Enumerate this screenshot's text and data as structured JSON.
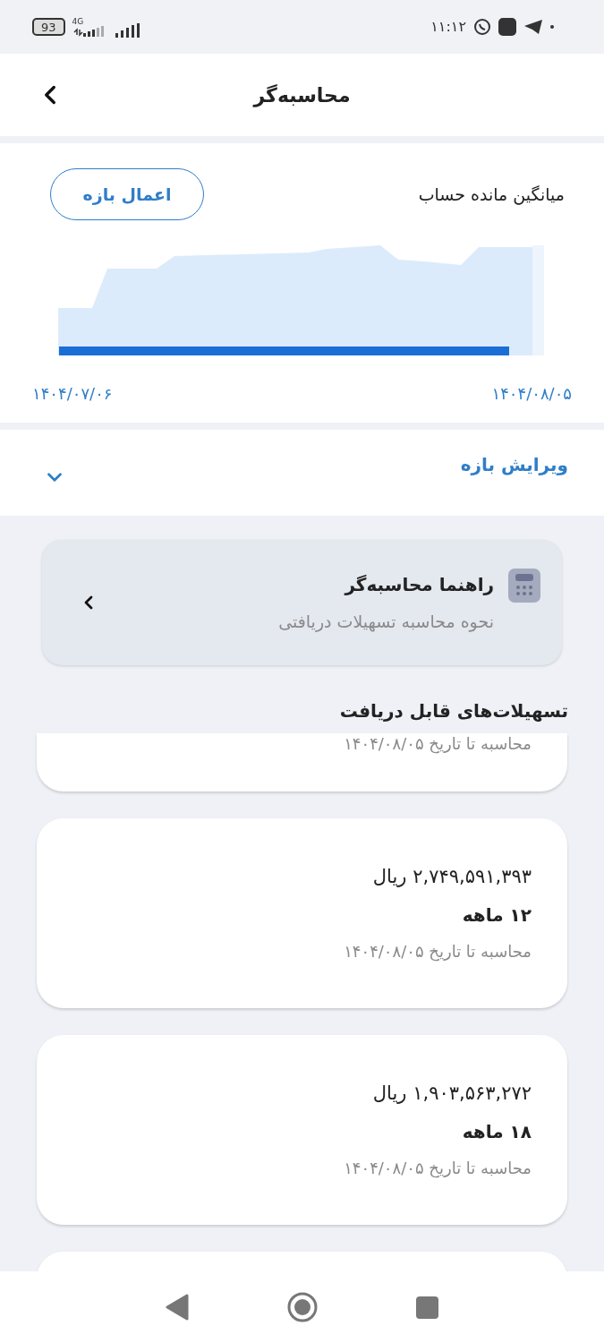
{
  "status_bar": {
    "battery": "93",
    "network": "4G",
    "time": "۱۱:۱۲"
  },
  "header": {
    "title": "محاسبه‌گر"
  },
  "balance_chart": {
    "title": "میانگین مانده حساب",
    "apply_button": "اعمال بازه",
    "start_date": "۱۴۰۴/۰۸/۰۵",
    "end_date": "۱۴۰۴/۰۷/۰۶"
  },
  "edit_range": {
    "label": "ویرایش بازه",
    "expanded": false
  },
  "guide": {
    "title": "راهنما محاسبه‌گر",
    "subtitle": "نحوه محاسبه تسهیلات دریافتی"
  },
  "loans_title": "تسهیلات‌های قابل دریافت",
  "loans": [
    {
      "date_line": "محاسبه تا تاریخ ۱۴۰۴/۰۸/۰۵"
    },
    {
      "amount": "۲,۷۴۹,۵۹۱,۳۹۳ ریال",
      "term": "۱۲ ماهه",
      "date_line": "محاسبه تا تاریخ ۱۴۰۴/۰۸/۰۵"
    },
    {
      "amount": "۱,۹۰۳,۵۶۳,۲۷۲ ریال",
      "term": "۱۸ ماهه",
      "date_line": "محاسبه تا تاریخ ۱۴۰۴/۰۸/۰۵"
    }
  ]
}
